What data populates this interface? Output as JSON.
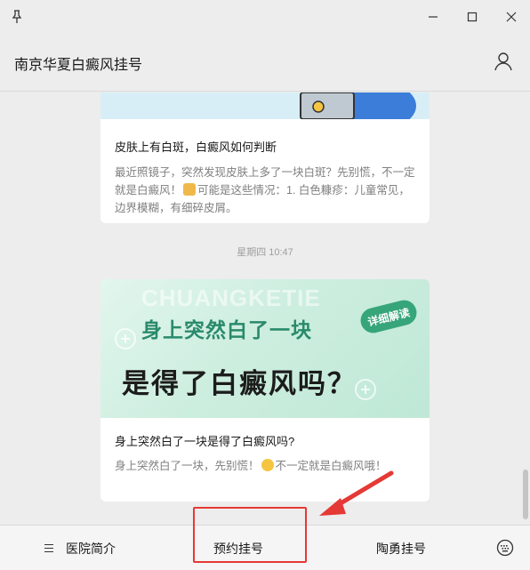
{
  "window": {
    "title": "南京华夏白癜风挂号"
  },
  "messages": {
    "card1": {
      "title": "皮肤上有白斑，白癜风如何判断",
      "desc_a": "最近照镜子，突然发现皮肤上多了一块白斑？先别慌，不一定就是白癜风！",
      "desc_b": "可能是这些情况：1. 白色糠疹：儿童常见，边界模糊，有细碎皮屑。"
    },
    "timestamp": "星期四 10:47",
    "card2": {
      "banner_watermark": "CHUANGKETIE",
      "banner_line1": "身上突然白了一块",
      "banner_line2": "是得了白癜风吗？",
      "banner_tag": "详细解读",
      "title": "身上突然白了一块是得了白癜风吗?",
      "desc_a": "身上突然白了一块，先别慌！",
      "desc_b": "不一定就是白癜风哦！"
    }
  },
  "bottom_menu": {
    "item1": "医院简介",
    "item2": "预约挂号",
    "item3": "陶勇挂号"
  },
  "icons": {
    "pin": "pin-icon",
    "minimize": "minimize-icon",
    "maximize": "maximize-icon",
    "close": "close-icon",
    "profile": "profile-icon",
    "menu": "menu-lines-icon",
    "keyboard": "keyboard-icon",
    "emoji_hand": "pointing-hand-emoji",
    "emoji_face": "thinking-face-emoji"
  },
  "colors": {
    "annotation": "#e53935",
    "banner_green": "#2a8a6c"
  }
}
